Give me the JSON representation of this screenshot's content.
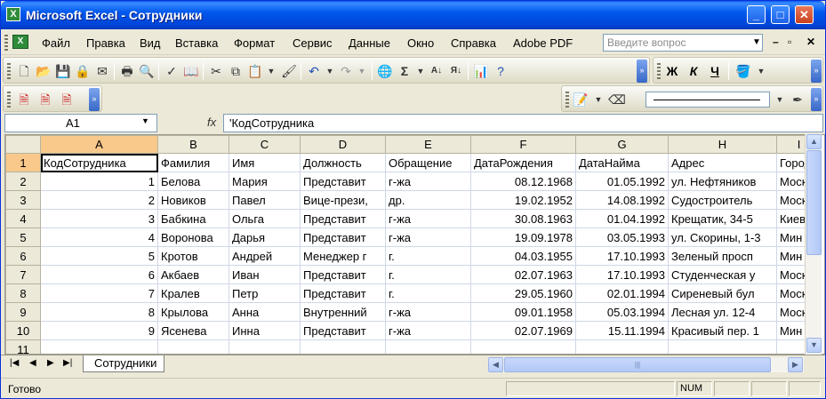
{
  "window": {
    "title": "Microsoft Excel - Сотрудники",
    "minimize": "_",
    "maximize": "□",
    "close": "✕"
  },
  "menu": {
    "items": [
      "Файл",
      "Правка",
      "Вид",
      "Вставка",
      "Формат",
      "Сервис",
      "Данные",
      "Окно",
      "Справка",
      "Adobe PDF"
    ],
    "help_placeholder": "Введите вопрос"
  },
  "formula_bar": {
    "name_box": "A1",
    "fx": "fx",
    "formula": "'КодСотрудника"
  },
  "grid": {
    "columns": [
      "A",
      "B",
      "C",
      "D",
      "E",
      "F",
      "G",
      "H",
      "I"
    ],
    "rows": [
      [
        "КодСотрудника",
        "Фамилия",
        "Имя",
        "Должность",
        "Обращение",
        "ДатаРождения",
        "ДатаНайма",
        "Адрес",
        "Город"
      ],
      [
        "1",
        "Белова",
        "Мария",
        "Представит",
        "г-жа",
        "08.12.1968",
        "01.05.1992",
        "ул. Нефтяников",
        "Моск"
      ],
      [
        "2",
        "Новиков",
        "Павел",
        "Вице-прези,",
        "др.",
        "19.02.1952",
        "14.08.1992",
        "Судостроитель",
        "Моск"
      ],
      [
        "3",
        "Бабкина",
        "Ольга",
        "Представит",
        "г-жа",
        "30.08.1963",
        "01.04.1992",
        "Крещатик, 34-5",
        "Киев"
      ],
      [
        "4",
        "Воронова",
        "Дарья",
        "Представит",
        "г-жа",
        "19.09.1978",
        "03.05.1993",
        "ул. Скорины, 1-3",
        "Мин"
      ],
      [
        "5",
        "Кротов",
        "Андрей",
        "Менеджер г",
        "г.",
        "04.03.1955",
        "17.10.1993",
        "Зеленый просп",
        "Мин"
      ],
      [
        "6",
        "Акбаев",
        "Иван",
        "Представит",
        "г.",
        "02.07.1963",
        "17.10.1993",
        "Студенческая у",
        "Моск"
      ],
      [
        "7",
        "Кралев",
        "Петр",
        "Представит",
        "г.",
        "29.05.1960",
        "02.01.1994",
        "Сиреневый бул",
        "Моск"
      ],
      [
        "8",
        "Крылова",
        "Анна",
        "Внутренний",
        "г-жа",
        "09.01.1958",
        "05.03.1994",
        "Лесная ул. 12-4",
        "Моск"
      ],
      [
        "9",
        "Ясенева",
        "Инна",
        "Представит",
        "г-жа",
        "02.07.1969",
        "15.11.1994",
        "Красивый пер. 1",
        "Мин"
      ],
      [
        "",
        "",
        "",
        "",
        "",
        "",
        "",
        "",
        ""
      ]
    ]
  },
  "sheet_tabs": [
    "Сотрудники"
  ],
  "status": {
    "text": "Готово",
    "num": "NUM"
  },
  "toolbar_format": {
    "bold": "Ж",
    "italic": "К",
    "underline": "Ч"
  }
}
